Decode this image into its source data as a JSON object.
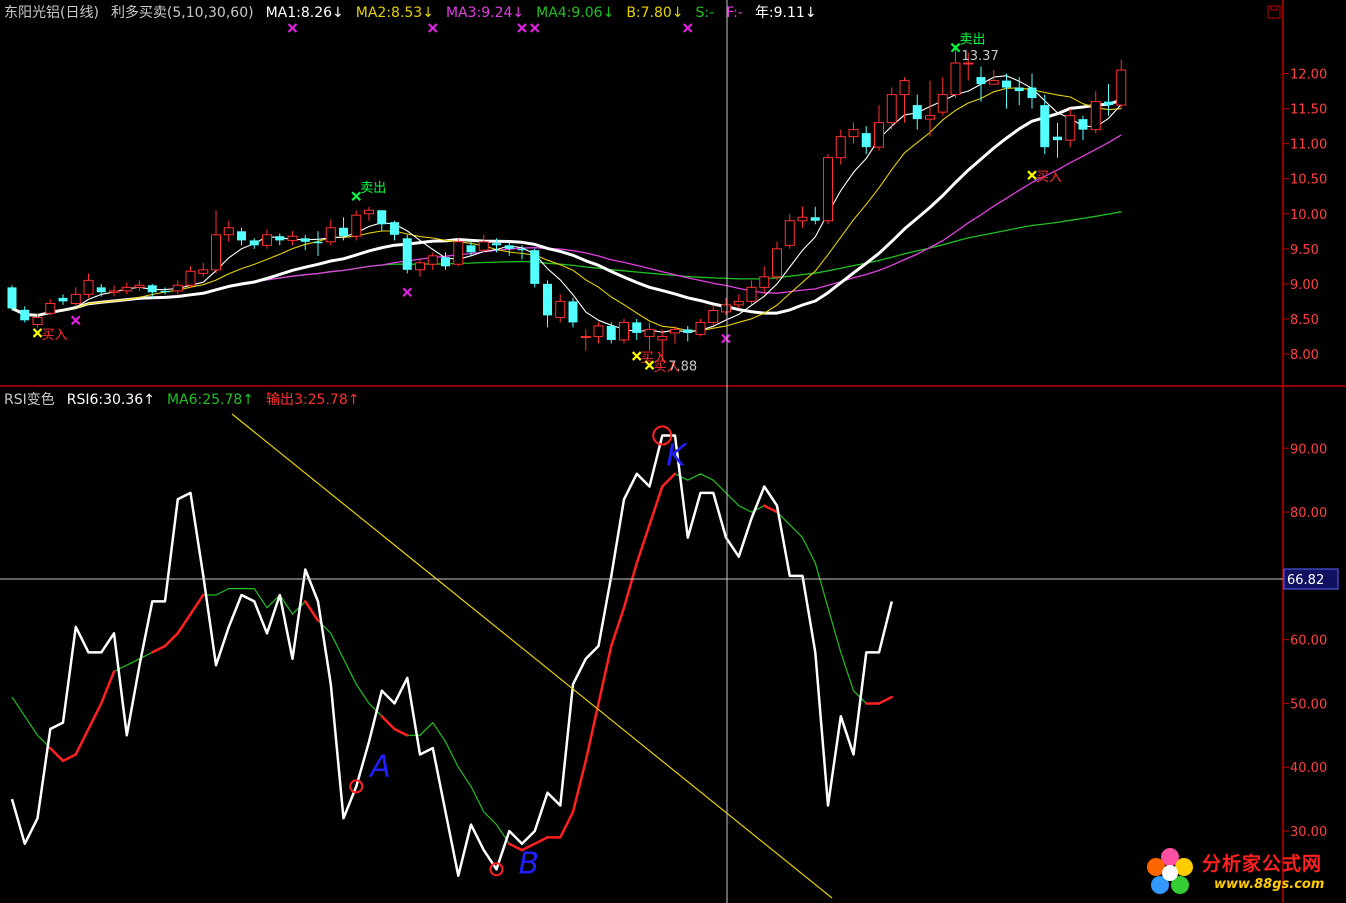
{
  "colors": {
    "up": "#ff3030",
    "down": "#54ffff",
    "ma1": "#ffffff",
    "ma2": "#e6d200",
    "ma3": "#e040e0",
    "ma4": "#20c020",
    "yearline": "#ffffff",
    "rsi": "#ffffff",
    "rsi_signal_low": "#ff2020",
    "rsi_signal": "#20c020",
    "frame": "#c00000",
    "axis_text": "#ff4040",
    "trendline": "#e6d200",
    "annotation": "#2020ff",
    "buy": "#ffff00",
    "sell": "#00ff40"
  },
  "header": {
    "segments": [
      {
        "text": "东阳光铝(日线)",
        "color": "#c8c8c8"
      },
      {
        "text": "利多买卖(5,10,30,60)",
        "color": "#c8c8c8"
      },
      {
        "text": "MA1:8.26↓",
        "color": "#ffffff"
      },
      {
        "text": "MA2:8.53↓",
        "color": "#e6d200"
      },
      {
        "text": "MA3:9.24↓",
        "color": "#e040e0"
      },
      {
        "text": "MA4:9.06↓",
        "color": "#20c020"
      },
      {
        "text": "B:7.80↓",
        "color": "#e6d200"
      },
      {
        "text": "S:-",
        "color": "#20c020"
      },
      {
        "text": "F:-",
        "color": "#e040e0"
      },
      {
        "text": "年:9.11↓",
        "color": "#ffffff"
      }
    ],
    "box_icon": "window-restore-icon"
  },
  "rsi_header": {
    "segments": [
      {
        "text": "RSI变色",
        "color": "#c8c8c8"
      },
      {
        "text": "RSI6:30.36↑",
        "color": "#ffffff"
      },
      {
        "text": "MA6:25.78↑",
        "color": "#20c020"
      },
      {
        "text": "输出3:25.78↑",
        "color": "#ff3030"
      }
    ]
  },
  "chart_data": [
    {
      "type": "candlestick",
      "title": "东阳光铝(日线)",
      "ylim": [
        7.6,
        12.65
      ],
      "yticks": [
        "12.00",
        "11.50",
        "11.00",
        "10.50",
        "10.00",
        "9.50",
        "9.00",
        "8.50",
        "8.00"
      ],
      "ytick_values": [
        12.0,
        11.5,
        11.0,
        10.5,
        10.0,
        9.5,
        9.0,
        8.5,
        8.0
      ],
      "candles": [
        [
          8.95,
          8.65,
          8.98,
          8.62
        ],
        [
          8.63,
          8.48,
          8.68,
          8.45
        ],
        [
          8.42,
          8.52,
          8.58,
          8.38
        ],
        [
          8.58,
          8.72,
          8.78,
          8.55
        ],
        [
          8.8,
          8.75,
          8.85,
          8.7
        ],
        [
          8.72,
          8.85,
          8.95,
          8.68
        ],
        [
          8.85,
          9.05,
          9.15,
          8.8
        ],
        [
          8.95,
          8.88,
          9.0,
          8.82
        ],
        [
          8.88,
          8.9,
          8.98,
          8.82
        ],
        [
          8.9,
          8.95,
          9.02,
          8.85
        ],
        [
          8.95,
          8.98,
          9.05,
          8.9
        ],
        [
          8.98,
          8.88,
          9.0,
          8.8
        ],
        [
          8.9,
          8.88,
          8.95,
          8.85
        ],
        [
          8.9,
          8.98,
          9.05,
          8.85
        ],
        [
          8.98,
          9.18,
          9.25,
          8.95
        ],
        [
          9.15,
          9.2,
          9.3,
          9.1
        ],
        [
          9.2,
          9.7,
          10.05,
          9.15
        ],
        [
          9.7,
          9.8,
          9.9,
          9.6
        ],
        [
          9.75,
          9.62,
          9.8,
          9.55
        ],
        [
          9.62,
          9.55,
          9.65,
          9.5
        ],
        [
          9.55,
          9.7,
          9.78,
          9.5
        ],
        [
          9.68,
          9.62,
          9.72,
          9.55
        ],
        [
          9.62,
          9.68,
          9.75,
          9.55
        ],
        [
          9.65,
          9.6,
          9.7,
          9.48
        ],
        [
          9.6,
          9.58,
          9.75,
          9.4
        ],
        [
          9.6,
          9.8,
          9.92,
          9.55
        ],
        [
          9.8,
          9.68,
          9.95,
          9.62
        ],
        [
          9.68,
          9.98,
          10.05,
          9.62
        ],
        [
          10.0,
          10.05,
          10.1,
          9.9
        ],
        [
          10.05,
          9.85,
          10.05,
          9.75
        ],
        [
          9.88,
          9.7,
          9.9,
          9.62
        ],
        [
          9.65,
          9.2,
          9.7,
          9.15
        ],
        [
          9.2,
          9.3,
          9.35,
          9.1
        ],
        [
          9.28,
          9.4,
          9.45,
          9.2
        ],
        [
          9.38,
          9.25,
          9.45,
          9.2
        ],
        [
          9.28,
          9.6,
          9.65,
          9.25
        ],
        [
          9.55,
          9.45,
          9.62,
          9.4
        ],
        [
          9.48,
          9.6,
          9.7,
          9.45
        ],
        [
          9.58,
          9.55,
          9.65,
          9.45
        ],
        [
          9.55,
          9.5,
          9.6,
          9.4
        ],
        [
          9.5,
          9.48,
          9.55,
          9.35
        ],
        [
          9.48,
          9.0,
          9.5,
          8.95
        ],
        [
          9.0,
          8.55,
          9.05,
          8.38
        ],
        [
          8.52,
          8.75,
          8.85,
          8.45
        ],
        [
          8.75,
          8.45,
          8.8,
          8.38
        ],
        [
          8.25,
          8.25,
          8.35,
          8.05
        ],
        [
          8.25,
          8.4,
          8.45,
          8.15
        ],
        [
          8.4,
          8.2,
          8.45,
          8.15
        ],
        [
          8.2,
          8.45,
          8.5,
          8.15
        ],
        [
          8.45,
          8.3,
          8.5,
          8.2
        ],
        [
          8.25,
          8.35,
          8.45,
          8.05
        ],
        [
          8.2,
          8.25,
          8.35,
          7.9
        ],
        [
          8.3,
          8.35,
          8.4,
          8.15
        ],
        [
          8.35,
          8.3,
          8.4,
          8.18
        ],
        [
          8.28,
          8.45,
          8.5,
          8.25
        ],
        [
          8.45,
          8.62,
          8.7,
          8.4
        ],
        [
          8.6,
          8.7,
          8.8,
          8.55
        ],
        [
          8.7,
          8.75,
          8.85,
          8.65
        ],
        [
          8.75,
          8.95,
          9.05,
          8.7
        ],
        [
          8.95,
          9.1,
          9.25,
          8.85
        ],
        [
          9.1,
          9.5,
          9.6,
          9.05
        ],
        [
          9.55,
          9.9,
          10.0,
          9.5
        ],
        [
          9.9,
          9.95,
          10.1,
          9.8
        ],
        [
          9.95,
          9.9,
          10.1,
          9.85
        ],
        [
          9.9,
          10.8,
          10.85,
          9.85
        ],
        [
          10.8,
          11.1,
          11.2,
          10.7
        ],
        [
          11.1,
          11.2,
          11.3,
          11.0
        ],
        [
          11.15,
          10.95,
          11.25,
          10.85
        ],
        [
          10.95,
          11.3,
          11.55,
          10.9
        ],
        [
          11.3,
          11.7,
          11.8,
          11.2
        ],
        [
          11.7,
          11.9,
          11.95,
          11.3
        ],
        [
          11.55,
          11.35,
          11.7,
          11.2
        ],
        [
          11.35,
          11.4,
          11.9,
          11.1
        ],
        [
          11.45,
          11.7,
          11.95,
          11.4
        ],
        [
          11.7,
          12.15,
          12.4,
          11.65
        ],
        [
          12.15,
          12.15,
          12.3,
          11.9
        ],
        [
          11.95,
          11.85,
          12.1,
          11.6
        ],
        [
          11.85,
          11.9,
          12.05,
          11.85
        ],
        [
          11.9,
          11.8,
          12.0,
          11.5
        ],
        [
          11.8,
          11.75,
          11.95,
          11.55
        ],
        [
          11.8,
          11.65,
          12.0,
          11.5
        ],
        [
          11.55,
          10.95,
          11.7,
          10.85
        ],
        [
          11.1,
          11.05,
          11.3,
          10.8
        ],
        [
          11.05,
          11.4,
          11.5,
          10.95
        ],
        [
          11.35,
          11.2,
          11.4,
          11.05
        ],
        [
          11.2,
          11.6,
          11.75,
          11.15
        ],
        [
          11.6,
          11.55,
          11.85,
          11.4
        ],
        [
          11.55,
          12.05,
          12.2,
          11.5
        ]
      ],
      "signals": [
        {
          "label": "买入",
          "index": 2,
          "price": 8.3,
          "kind": "buy"
        },
        {
          "label": "卖出",
          "index": 27,
          "price": 10.25,
          "kind": "sell"
        },
        {
          "label": "买入",
          "index": 49,
          "price": 7.97,
          "kind": "buy"
        },
        {
          "label": "买入",
          "index": 50,
          "price": 7.84,
          "kind": "buy"
        },
        {
          "label": "卖出",
          "index": 74,
          "price": 12.37,
          "kind": "sell"
        },
        {
          "label": "买入",
          "index": 80,
          "price": 10.55,
          "kind": "buy"
        }
      ],
      "magenta_marks_low": [
        {
          "index": 5,
          "price": 8.48
        },
        {
          "index": 31,
          "price": 8.88
        },
        {
          "index": 56,
          "price": 8.22
        }
      ],
      "magenta_marks_top": [
        22,
        33,
        40,
        41,
        53
      ],
      "price_labels": [
        {
          "text": "7.88",
          "index": 51,
          "price": 7.82
        },
        {
          "text": "13.37",
          "index": 74,
          "price": 12.25
        }
      ]
    },
    {
      "type": "line",
      "title": "RSI变色",
      "ylim": [
        19.5,
        96.0
      ],
      "yticks": [
        "90.00",
        "80.00",
        "70.00",
        "60.00",
        "50.00",
        "40.00",
        "30.00"
      ],
      "ytick_values": [
        90,
        80,
        70,
        60,
        50,
        40,
        30
      ],
      "crosshair_value": "66.82",
      "series": [
        {
          "name": "RSI6",
          "values": [
            35,
            28,
            32,
            46,
            47,
            62,
            58,
            58,
            61,
            45,
            56,
            66,
            66,
            82,
            83,
            70,
            56,
            62,
            67,
            66,
            61,
            67,
            57,
            71,
            66,
            53,
            32,
            37,
            44,
            52,
            50,
            54,
            42,
            43,
            33,
            23,
            31,
            27,
            24,
            30,
            28,
            30,
            36,
            34,
            53,
            57,
            59,
            70,
            82,
            86,
            84,
            92,
            92,
            76,
            83,
            83,
            76,
            73,
            79,
            84,
            81,
            70,
            70,
            58,
            34,
            48,
            42,
            58,
            58,
            66
          ]
        },
        {
          "name": "MA6",
          "values": [
            51,
            48,
            45,
            43,
            41,
            42,
            46,
            50,
            55,
            56,
            57,
            58,
            59,
            61,
            64,
            67,
            67,
            68,
            68,
            68,
            65,
            67,
            64,
            66,
            63,
            61,
            57,
            53,
            50,
            48,
            46,
            45,
            45,
            47,
            44,
            40,
            37,
            33,
            31,
            28,
            27,
            28,
            29,
            29,
            33,
            41,
            50,
            59,
            65,
            72,
            78,
            84,
            86,
            85,
            86,
            85,
            83,
            81,
            80,
            81,
            80,
            78,
            76,
            72,
            65,
            58,
            52,
            50,
            50,
            51
          ]
        },
        {
          "name": "输出3",
          "values": [
            51,
            48,
            45,
            43,
            41,
            42,
            46,
            50,
            55,
            56,
            57,
            58,
            59,
            61,
            64,
            67,
            67,
            68,
            68,
            68,
            65,
            67,
            64,
            66,
            63,
            61,
            57,
            53,
            50,
            48,
            46,
            45,
            45,
            47,
            44,
            40,
            37,
            33,
            31,
            28,
            27,
            28,
            29,
            29,
            33,
            41,
            50,
            59,
            65,
            72,
            78,
            84,
            86,
            85,
            86,
            85,
            83,
            81,
            80,
            81,
            80,
            78,
            76,
            72,
            65,
            58,
            52,
            50,
            50,
            51
          ]
        }
      ],
      "annotations": [
        {
          "text": "A",
          "index": 27
        },
        {
          "text": "B",
          "index": 38
        },
        {
          "text": "K",
          "index": 51
        }
      ],
      "circled_points": [
        27,
        38,
        51
      ]
    }
  ],
  "watermark": {
    "brand": "分析家公式网",
    "url": "www.88gs.com",
    "icon": "flower-logo-icon"
  }
}
